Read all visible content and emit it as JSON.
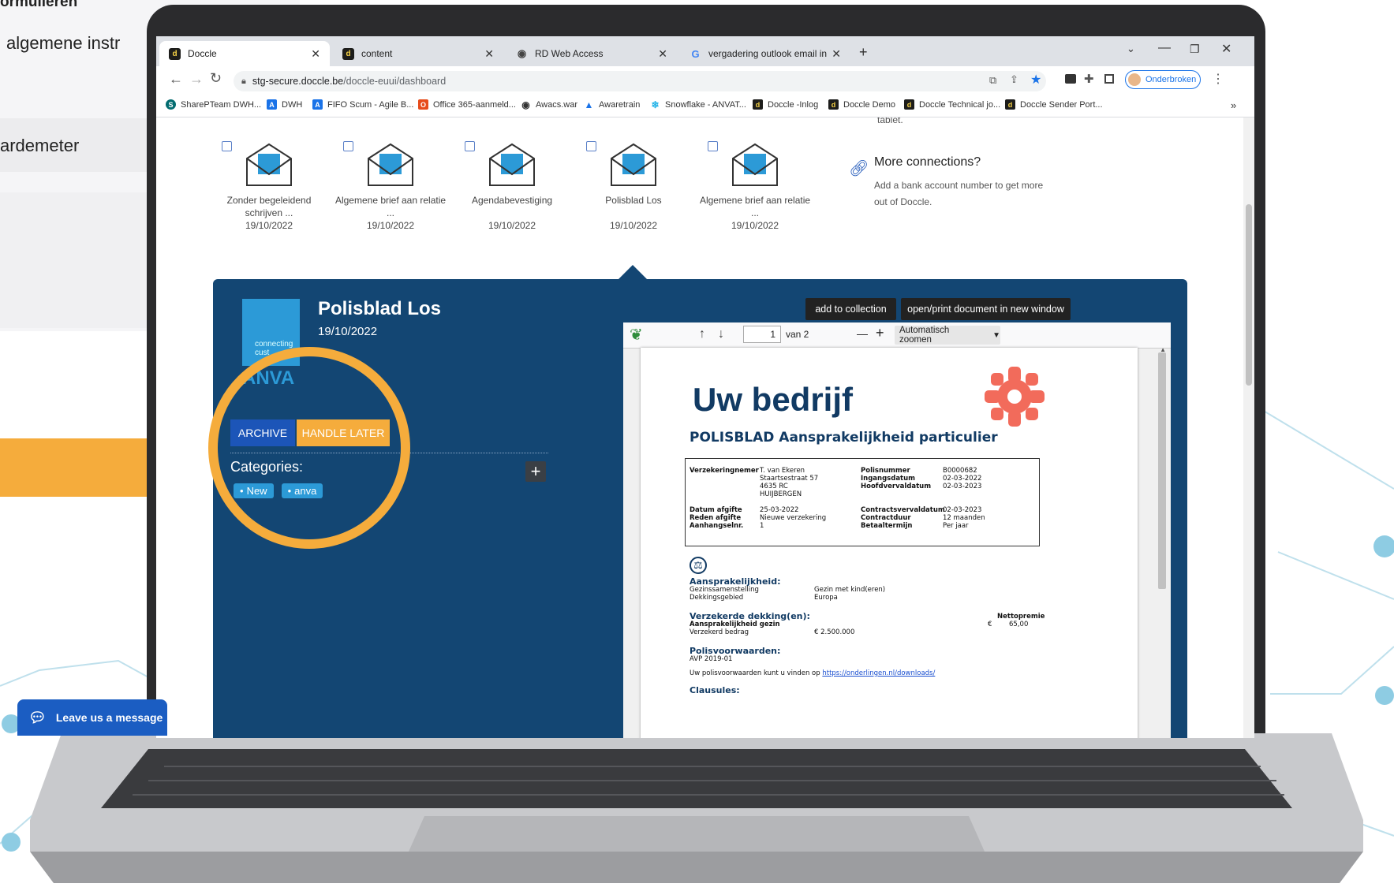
{
  "background": {
    "heading_partial": "ormulieren",
    "line_partial": "algemene instr",
    "item_partial": "ardemeter"
  },
  "browser": {
    "tabs": [
      {
        "label": "Doccle",
        "active": true
      },
      {
        "label": "content",
        "active": false
      },
      {
        "label": "RD Web Access",
        "active": false
      },
      {
        "label": "vergadering outlook email in bcc",
        "active": false
      }
    ],
    "new_tab": "+",
    "url_domain": "stg-secure.doccle.be",
    "url_path": "/doccle-euui/dashboard",
    "profile_label": "Onderbroken",
    "bookmarks": [
      "SharePTeam DWH...",
      "DWH",
      "FIFO Scum - Agile B...",
      "Office 365-aanmeld...",
      "Awacs.war",
      "Awaretrain",
      "Snowflake - ANVAT...",
      "Doccle -Inlog",
      "Doccle Demo",
      "Doccle Technical jo...",
      "Doccle Sender Port..."
    ],
    "bookmarks_more": "»"
  },
  "documents": [
    {
      "title": "Zonder begeleidend schrijven ...",
      "date": "19/10/2022"
    },
    {
      "title": "Algemene brief aan relatie ...",
      "date": "19/10/2022"
    },
    {
      "title": "Agendabevestiging",
      "date": "19/10/2022"
    },
    {
      "title": "Polisblad Los",
      "date": "19/10/2022"
    },
    {
      "title": "Algemene brief aan relatie ...",
      "date": "19/10/2022"
    }
  ],
  "side_top_text": "tablet.",
  "more_connections": {
    "title": "More connections?",
    "text": "Add a bank account number to get more out of Doccle."
  },
  "detail": {
    "title": "Polisblad Los",
    "date": "19/10/2022",
    "logo_tagline": "connecting cust",
    "logo_name": "ANVA",
    "archive_label": "ARCHIVE",
    "handle_later_label": "HANDLE LATER",
    "categories_label": "Categories:",
    "categories": [
      "New",
      "anva"
    ],
    "add_category": "+",
    "add_to_collection": "add to collection",
    "open_print": "open/print document in new window"
  },
  "viewer": {
    "page_number": "1",
    "page_of": "van 2",
    "zoom_label": "Automatisch zoomen",
    "zoom_minus": "—",
    "zoom_plus": "+"
  },
  "pdf": {
    "company": "Uw bedrijf",
    "heading": "POLISBLAD Aansprakelijkheid particulier",
    "box": {
      "l1": [
        "Verzekeringnemer"
      ],
      "v1": [
        "T. van Ekeren",
        "Staartsestraat 57",
        "4635 RC",
        "HUIJBERGEN"
      ],
      "l2": [
        "Polisnummer",
        "Ingangsdatum",
        "Hoofdvervaldatum"
      ],
      "v2": [
        "B0000682",
        "02-03-2022",
        "02-03-2023"
      ],
      "l3": [
        "Datum afgifte",
        "Reden afgifte",
        "Aanhangselnr."
      ],
      "v3": [
        "25-03-2022",
        "Nieuwe verzekering",
        "1"
      ],
      "l4": [
        "Contractsvervaldatum",
        "Contractduur",
        "Betaaltermijn"
      ],
      "v4": [
        "02-03-2023",
        "12 maanden",
        "Per jaar"
      ]
    },
    "section1_title": "Aansprakelijkheid:",
    "s1_rows": [
      [
        "Gezinssamenstelling",
        "Gezin met kind(eren)"
      ],
      [
        "Dekkingsgebied",
        "Europa"
      ]
    ],
    "section2_title": "Verzekerde dekking(en):",
    "s2_sub": "Aansprakelijkheid gezin",
    "s2_label": "Verzekerd bedrag",
    "s2_value": "€ 2.500.000",
    "netto_label": "Nettopremie",
    "netto_value": "€        65,00",
    "section3_title": "Polisvoorwaarden:",
    "s3_value": "AVP 2019-01",
    "s3_text": "Uw polisvoorwaarden kunt u vinden op",
    "s3_link": "https://onderlingen.nl/downloads/",
    "section4_title": "Clausules:"
  },
  "chat": {
    "label": "Leave us a message"
  },
  "colors": {
    "panel": "#134673",
    "accent_orange": "#f5ac3c",
    "archive_blue": "#1c55b8",
    "chip_blue": "#2c9ad7"
  }
}
